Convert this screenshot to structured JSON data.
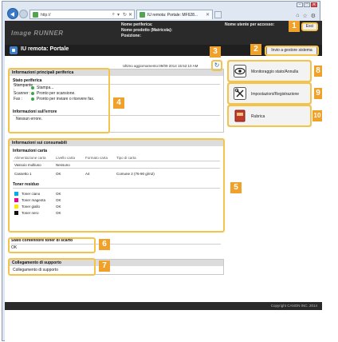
{
  "browser": {
    "url": "http://",
    "address_icons": {
      "search": "⌕",
      "separator": "▾",
      "refresh": "↻",
      "stop": "✕"
    },
    "tab_title": "IU remota: Portale: MF628...",
    "window_controls": [
      "–",
      "□",
      "✕"
    ],
    "toolbar_icons": [
      "home-icon",
      "star-icon",
      "gear-icon"
    ]
  },
  "header": {
    "logo": "Image RUNNER",
    "device_name_label": "Nome periferica:",
    "device_name_value": "",
    "product_label": "Nome prodotto (Matricola):",
    "product_value": "",
    "position_label": "Posizione:",
    "user_label": "Nome utente per accesso:",
    "exit_label": "Esci",
    "page_title": "IU remota: Portale",
    "mgmt_button": "Invio a gestore sistema"
  },
  "updated": "Ultimo aggiornamento:09/09 2014 15:52:10 AM",
  "device_info": {
    "title": "Informazioni principali periferica",
    "status_title": "Stato periferica",
    "status_rows": [
      {
        "key": "Stampante :",
        "value": "Stampa..."
      },
      {
        "key": "Scanner :",
        "value": "Pronto per scansione."
      },
      {
        "key": "Fax :",
        "value": "Pronto per inviare o ricevere fax."
      }
    ],
    "error_title": "Informazioni sull'errore",
    "error_value": "Nessun errore."
  },
  "consumables": {
    "title": "Informazioni sui consumabili",
    "paper_title": "Informazioni carta",
    "columns": [
      "Alimentazione carta",
      "Livello carta",
      "Formato carta",
      "Tipo di carta"
    ],
    "rows": [
      [
        "Vassoio multiuso",
        "Nessuno",
        "",
        ""
      ],
      [
        "Cassetto 1",
        "OK",
        "A4",
        "Comune 2 (76-90 g/m2)"
      ]
    ],
    "toner_title": "Toner residuo",
    "toners": [
      {
        "name": "Toner ciano",
        "status": "OK",
        "color": "#00aeef"
      },
      {
        "name": "Toner magenta",
        "status": "OK",
        "color": "#ec008c"
      },
      {
        "name": "Toner giallo",
        "status": "OK",
        "color": "#ffe600"
      },
      {
        "name": "Toner nero",
        "status": "OK",
        "color": "#111111"
      }
    ]
  },
  "waste": {
    "title": "Stato contenitore toner di scarto",
    "value": "OK"
  },
  "support": {
    "title": "Collegamento di supporto",
    "value": "Collegamento di supporto"
  },
  "side_buttons": [
    {
      "label": "Monitoraggio stato/Annulla",
      "icon": "eye-icon"
    },
    {
      "label": "Impostazioni/Registrazione",
      "icon": "tools-icon"
    },
    {
      "label": "Rubrica",
      "icon": "address-book-icon"
    }
  ],
  "callouts": [
    "1",
    "2",
    "3",
    "4",
    "5",
    "6",
    "7",
    "8",
    "9",
    "10"
  ],
  "footer": "Copyright CANON INC. 2014",
  "colors": {
    "accent": "#f0a12a",
    "highlight": "#f4c34a",
    "header_bg": "#2a2a2a",
    "ok_dot": "#39a84a"
  }
}
